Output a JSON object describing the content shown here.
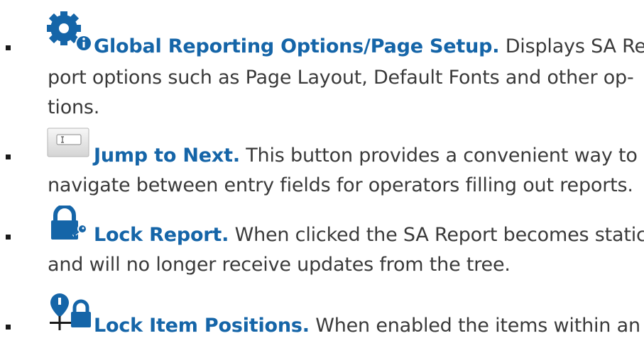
{
  "colors": {
    "accent_blue": "#1565a8",
    "body_text": "#3a3a3a",
    "bullet": "#1a1a1a"
  },
  "items": [
    {
      "icon": "gear-info-icon",
      "title": "Global Reporting Options/Page Setup.",
      "first_line": " Displays SA Re-",
      "lines": [
        "port options such as Page Layout, Default Fonts and other op-",
        "tions."
      ]
    },
    {
      "icon": "text-field-button-icon",
      "title": "Jump to Next.",
      "first_line": " This button provides a convenient way to",
      "lines": [
        "navigate between entry fields for operators filling out reports."
      ]
    },
    {
      "icon": "padlock-icon",
      "title": "Lock Report.",
      "first_line": " When clicked the SA Report becomes static",
      "lines": [
        "and will no longer receive updates from the tree."
      ]
    },
    {
      "icon": "pin-lock-icon",
      "title": "Lock Item Positions.",
      "first_line": " When enabled the items within an",
      "lines": []
    }
  ]
}
